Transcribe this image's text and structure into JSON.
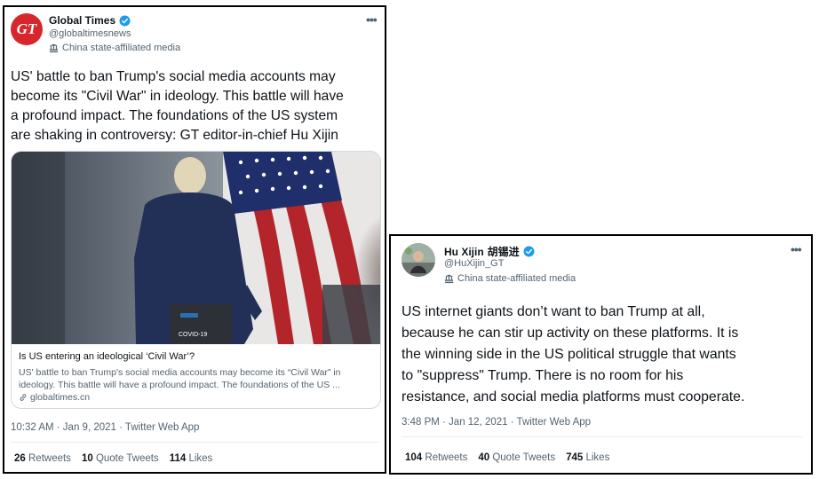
{
  "tweet1": {
    "author": {
      "display_name": "Global Times",
      "avatar_text": "GT",
      "handle": "@globaltimesnews",
      "affiliation": "China state-affiliated media"
    },
    "more_glyph": "•••",
    "text_lines": [
      "US' battle to ban Trump's social media accounts may",
      "become its \"Civil War\" in ideology. This battle will have",
      "a profound impact. The foundations of the US system",
      "are shaking in controversy: GT editor-in-chief Hu Xijin"
    ],
    "card": {
      "image_caption": "COVID-19",
      "title": "Is US entering an ideological ‘Civil War’?",
      "description_lines": [
        "US' battle to ban Trump's social media accounts may become its “Civil War” in",
        "ideology. This battle will have a profound impact. The foundations of the US ..."
      ],
      "domain": "globaltimes.cn"
    },
    "timestamp": "10:32 AM · Jan 9, 2021 · Twitter Web App",
    "stats": {
      "retweets_count": "26",
      "retweets_label": "Retweets",
      "quotes_count": "10",
      "quotes_label": "Quote Tweets",
      "likes_count": "114",
      "likes_label": "Likes"
    }
  },
  "tweet2": {
    "author": {
      "display_name": "Hu Xijin",
      "display_name_cjk": "胡锡进",
      "handle": "@HuXijin_GT",
      "affiliation": "China state-affiliated media"
    },
    "more_glyph": "•••",
    "text_lines": [
      "US internet giants don’t want to ban Trump at all,",
      "because he can stir up activity on these platforms. It is",
      "the winning side in the US political struggle that wants",
      "to \"suppress\" Trump. There is no room for his",
      "resistance, and social media platforms must cooperate."
    ],
    "timestamp": "3:48 PM · Jan 12, 2021 · Twitter Web App",
    "stats": {
      "retweets_count": "104",
      "retweets_label": "Retweets",
      "quotes_count": "40",
      "quotes_label": "Quote Tweets",
      "likes_count": "745",
      "likes_label": "Likes"
    }
  },
  "colors": {
    "verified_blue": "#1d9bf0",
    "gt_red": "#d7262c",
    "muted_text": "#536471",
    "border": "#000000"
  },
  "icons": [
    "verified-badge-icon",
    "flag-icon",
    "more-options-icon",
    "link-icon"
  ]
}
